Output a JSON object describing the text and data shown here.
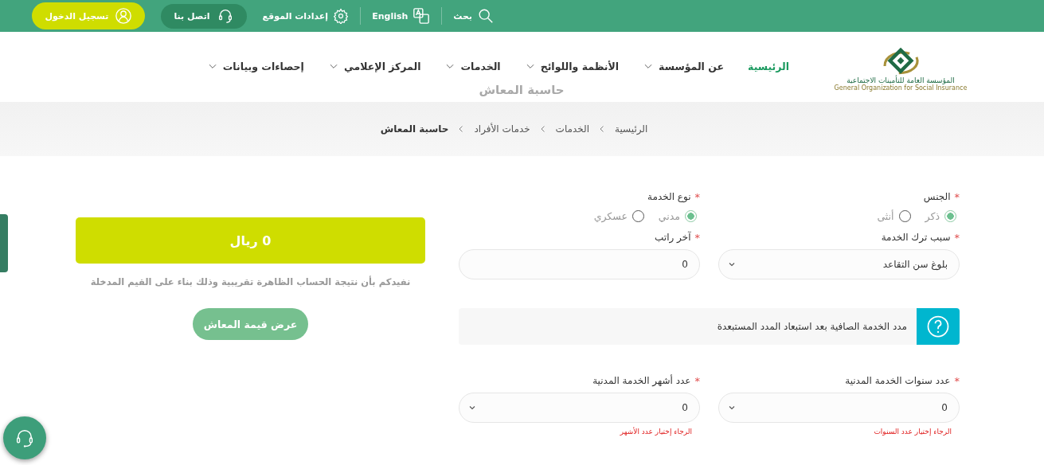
{
  "topbar": {
    "search": "بحث",
    "language": "English",
    "settings": "إعدادات الموقع",
    "contact": "اتصل بنا",
    "login": "تسجيل الدخول"
  },
  "logo": {
    "arabic": "المؤسسة العامة للتأمينات الاجتماعية",
    "english": "General Organization for Social Insurance"
  },
  "nav": [
    {
      "label": "الرئيسية",
      "selected": true,
      "has_menu": false
    },
    {
      "label": "عن المؤسسة",
      "selected": false,
      "has_menu": true
    },
    {
      "label": "الأنظمة واللوائح",
      "selected": false,
      "has_menu": true
    },
    {
      "label": "الخدمات",
      "selected": false,
      "has_menu": true
    },
    {
      "label": "المركز الإعلامي",
      "selected": false,
      "has_menu": true
    },
    {
      "label": "إحصاءات وبيانات",
      "selected": false,
      "has_menu": true
    }
  ],
  "page_title": "حاسبة المعاش",
  "breadcrumb": [
    {
      "label": "الرئيسية",
      "current": false
    },
    {
      "label": "الخدمات",
      "current": false
    },
    {
      "label": "خدمات الأفراد",
      "current": false
    },
    {
      "label": "حاسبة المعاش",
      "current": true
    }
  ],
  "form": [
    {
      "kind": "radio",
      "label": "الجنس",
      "required_mark": "*",
      "options": [
        {
          "label": "ذكر",
          "selected": true
        },
        {
          "label": "أنثى",
          "selected": false
        }
      ]
    },
    {
      "kind": "radio",
      "label": "نوع الخدمة",
      "required_mark": "*",
      "options": [
        {
          "label": "مدني",
          "selected": true
        },
        {
          "label": "عسكري",
          "selected": false
        }
      ]
    },
    {
      "kind": "select",
      "label": "سبب ترك الخدمة",
      "required_mark": "*",
      "value": "بلوغ سن التقاعد"
    },
    {
      "kind": "input",
      "label": "آخر راتب",
      "required_mark": "*",
      "value": "0"
    },
    {
      "kind": "info",
      "text": "مدد الخدمة الصافية بعد استبعاد المدد المستبعدة"
    },
    {
      "kind": "select",
      "label": "عدد سنوات الخدمة المدنية",
      "required_mark": "*",
      "value": "0",
      "error": "الرجاء إختيار عدد السنوات"
    },
    {
      "kind": "select",
      "label": "عدد أشهر الخدمة المدنية",
      "required_mark": "*",
      "value": "0",
      "error": "الرجاء إختيار عدد الأشهر"
    }
  ],
  "result": {
    "amount": "0 ريال",
    "note": "نفيدكم بأن نتيجة الحساب الظاهرة تقريبية وذلك بناء على القيم المدخلة",
    "button": "عرض قيمة المعاش"
  }
}
